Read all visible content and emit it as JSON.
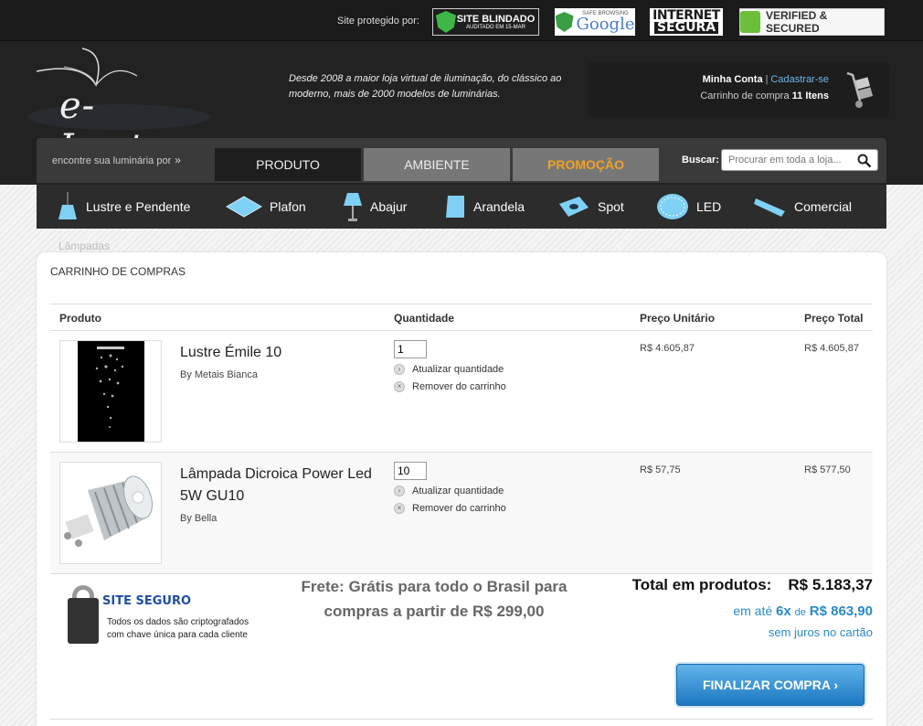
{
  "security": {
    "label": "Site protegido por:",
    "badges": {
      "site_blindado": "SITE BLINDADO",
      "site_blindado_sub": "AUDITADO EM 15-MAR",
      "google_sub": "SAFE BROWSING",
      "google": "Google",
      "internet": "INTERNET",
      "segura": "SEGURA",
      "godaddy": "VERIFIED & SECURED"
    }
  },
  "header": {
    "logo": "e-Lustre",
    "tagline": "Desde 2008 a maior loja virtual de iluminação, do clássico ao moderno, mais de 2000 modelos de luminárias.",
    "account_label": "Minha Conta",
    "register_label": "Cadastrar-se",
    "cart_text": "Carrinho de compra",
    "cart_count": "11 Itens"
  },
  "nav": {
    "find_label": "encontre sua luminária por",
    "tabs": [
      "PRODUTO",
      "AMBIENTE",
      "PROMOÇÃO"
    ],
    "search_label": "Buscar:",
    "search_placeholder": "Procurar em toda a loja..."
  },
  "categories": [
    "Lustre e Pendente",
    "Plafon",
    "Abajur",
    "Arandela",
    "Spot",
    "LED",
    "Comercial"
  ],
  "ghost_label": "Lâmpadas",
  "cart": {
    "title": "CARRINHO DE COMPRAS",
    "headers": [
      "Produto",
      "Quantidade",
      "Preço Unitário",
      "Preço Total"
    ],
    "update_label": "Atualizar quantidade",
    "remove_label": "Remover do carrinho",
    "items": [
      {
        "name": "Lustre Émile 10",
        "brand": "By Metais Bianca",
        "qty": "1",
        "unit": "R$ 4.605,87",
        "total": "R$ 4.605,87"
      },
      {
        "name": "Lâmpada Dicroica Power Led 5W GU10",
        "brand": "By Bella",
        "qty": "10",
        "unit": "R$ 57,75",
        "total": "R$ 577,50"
      }
    ]
  },
  "seal": {
    "title": "SITE SEGURO",
    "desc_line1": "Todos os dados são criptografados",
    "desc_line2": "com chave única para cada cliente"
  },
  "summary": {
    "frete": "Frete: Grátis para todo o Brasil para compras a partir de R$ 299,00",
    "total_label": "Total em produtos:",
    "total_value": "R$ 5.183,37",
    "installments_prefix": "em até",
    "installments_count": "6x",
    "installments_de": "de",
    "installments_value": "R$ 863,90",
    "no_interest": "sem juros no cartão",
    "checkout": "FINALIZAR COMPRA ›"
  },
  "colors": {
    "accent": "#2a8ac8",
    "promo": "#f0a224",
    "header_bg": "#222222"
  }
}
